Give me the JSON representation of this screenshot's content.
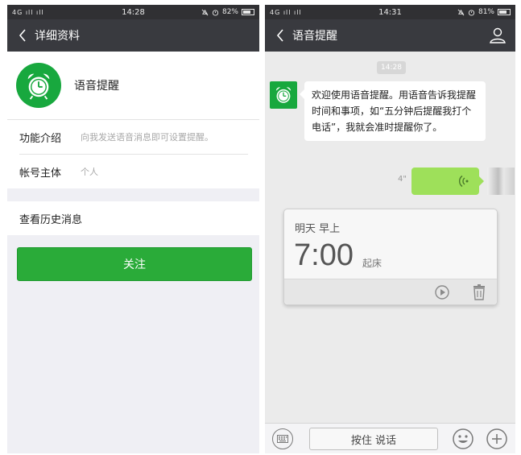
{
  "left_screen": {
    "status": {
      "signal": "4G ıll ıll",
      "time": "14:28",
      "battery": "82%",
      "battery_level": 0.82
    },
    "nav": {
      "title": "详细资料"
    },
    "profile": {
      "name": "语音提醒"
    },
    "rows": [
      {
        "label": "功能介绍",
        "value": "向我发送语音消息即可设置提醒。"
      },
      {
        "label": "帐号主体",
        "value": "个人"
      }
    ],
    "history": {
      "label": "查看历史消息"
    },
    "follow_button": {
      "label": "关注"
    }
  },
  "right_screen": {
    "status": {
      "signal": "4G ıll ıll",
      "time": "14:31",
      "battery": "81%",
      "battery_level": 0.81
    },
    "nav": {
      "title": "语音提醒"
    },
    "chat": {
      "timestamp": "14:28",
      "incoming_message": "欢迎使用语音提醒。用语音告诉我提醒时间和事项，如“五分钟后提醒我打个电话”，我就会准时提醒你了。",
      "voice_duration": "4\"",
      "alarm": {
        "date": "明天 早上",
        "time": "7:00",
        "label": "起床"
      }
    },
    "input_bar": {
      "hold_label": "按住 说话"
    }
  },
  "colors": {
    "nav_bg": "#393a3f",
    "status_bg": "#303033",
    "accent_green": "#2aab39",
    "icon_green": "#18a83e",
    "voice_bubble": "#9ee05a"
  },
  "icons": [
    "back-icon",
    "alarm-clock-icon",
    "profile-icon",
    "voice-wave-icon",
    "play-icon",
    "trash-icon",
    "keyboard-icon",
    "emoji-icon",
    "plus-icon"
  ]
}
